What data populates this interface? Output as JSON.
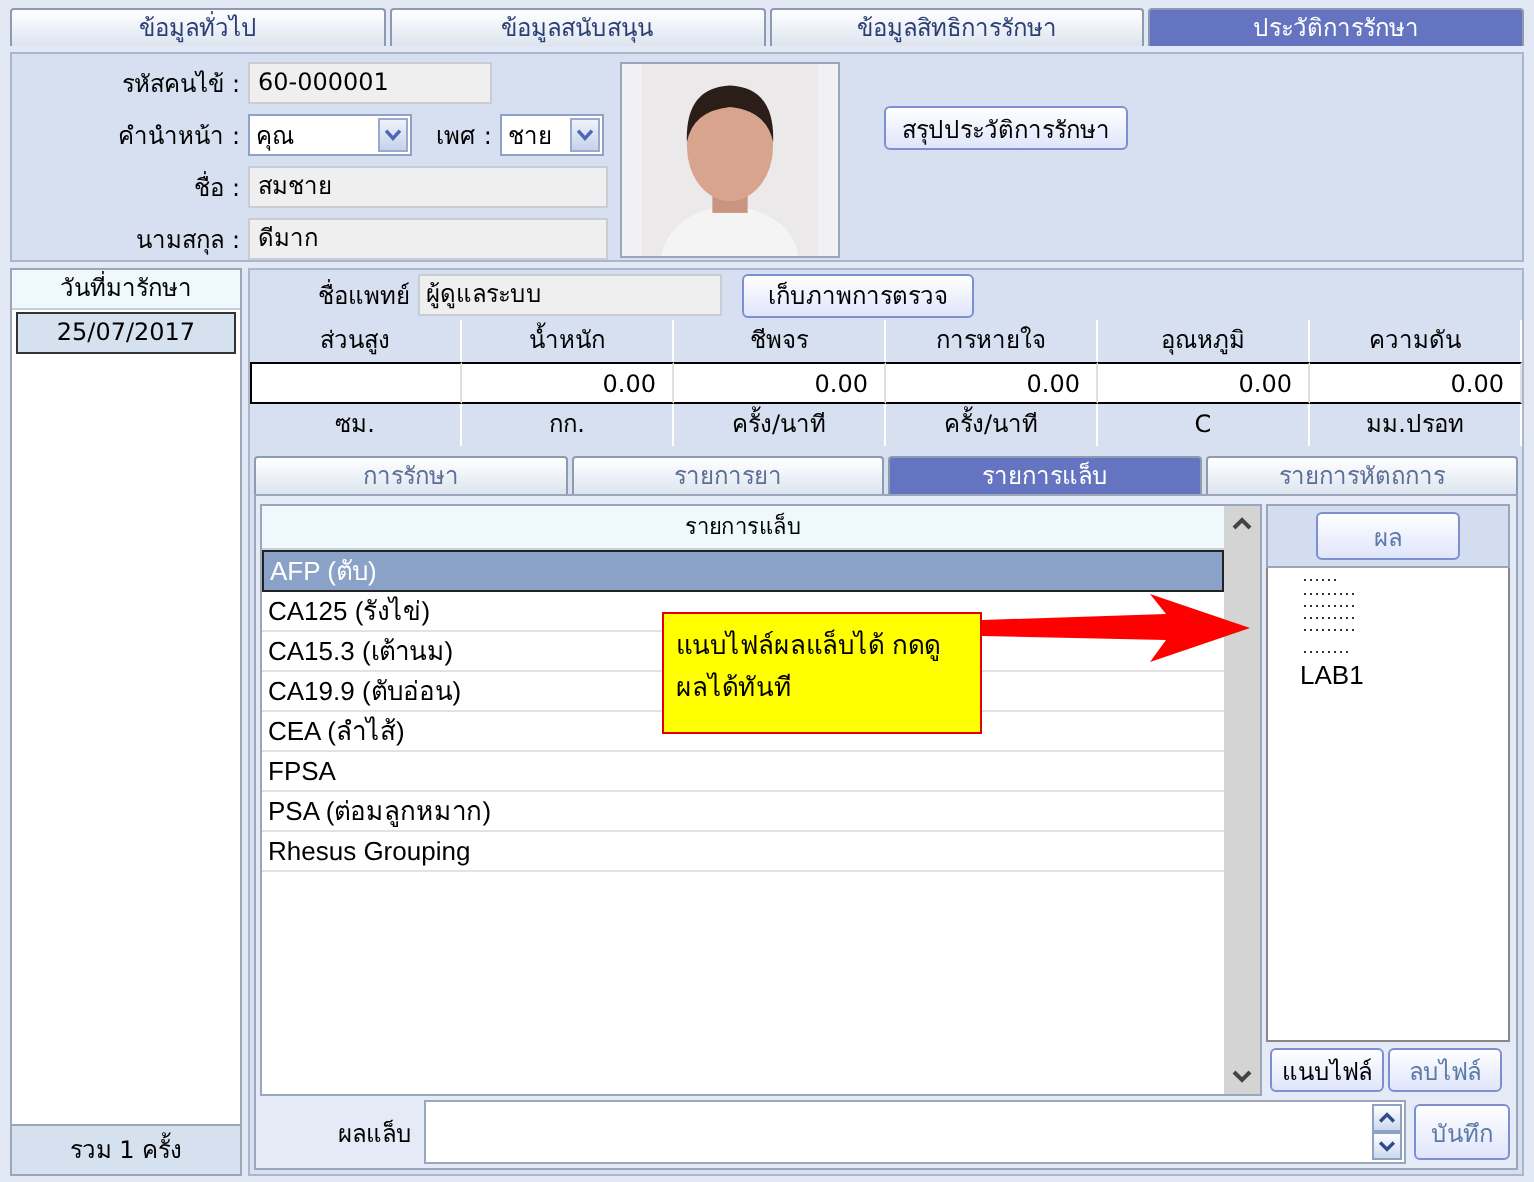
{
  "main_tabs": [
    {
      "label": "ข้อมูลทั่วไป",
      "selected": false
    },
    {
      "label": "ข้อมูลสนับสนุน",
      "selected": false
    },
    {
      "label": "ข้อมูลสิทธิการรักษา",
      "selected": false
    },
    {
      "label": "ประวัติการรักษา",
      "selected": true
    }
  ],
  "patient": {
    "id_label": "รหัสคนไข้ :",
    "id": "60-000001",
    "title_label": "คำนำหน้า :",
    "title": "คุณ",
    "sex_label": "เพศ :",
    "sex": "ชาย",
    "name_label": "ชื่อ :",
    "name": "สมชาย",
    "surname_label": "นามสกุล :",
    "surname": "ดีมาก",
    "summary_button": {
      "label": "สรุปประวัติการรักษา",
      "disabled": false
    }
  },
  "visits": {
    "header": "วันที่มารักษา",
    "items": [
      {
        "date": "25/07/2017",
        "selected": true
      }
    ],
    "footer": "รวม 1 ครั้ง"
  },
  "doctor": {
    "label": "ชื่อแพทย์",
    "value": "ผู้ดูแลระบบ",
    "button": {
      "label": "เก็บภาพการตรวจ",
      "disabled": false
    }
  },
  "vitals": {
    "columns": [
      {
        "name": "ส่วนสูง",
        "unit": "ซม."
      },
      {
        "name": "น้ำหนัก",
        "value": "0.00",
        "unit": "กก."
      },
      {
        "name": "ชีพจร",
        "value": "0.00",
        "unit": "ครั้ง/นาที"
      },
      {
        "name": "การหายใจ",
        "value": "0.00",
        "unit": "ครั้ง/นาที"
      },
      {
        "name": "อุณหภูมิ",
        "value": "0.00",
        "unit": "C"
      },
      {
        "name": "ความดัน",
        "value": "0.00",
        "unit": "มม.ปรอท"
      }
    ]
  },
  "sub_tabs": [
    {
      "label": "การรักษา",
      "selected": false
    },
    {
      "label": "รายการยา",
      "selected": false
    },
    {
      "label": "รายการแล็บ",
      "selected": true
    },
    {
      "label": "รายการหัตถการ",
      "selected": false
    }
  ],
  "lab_list": {
    "header": "รายการแล็บ",
    "rows": [
      {
        "name": "AFP (ตับ)",
        "selected": true
      },
      {
        "name": "CA125 (รังไข่)",
        "selected": false
      },
      {
        "name": "CA15.3 (เต้านม)",
        "selected": false
      },
      {
        "name": "CA19.9 (ตับอ่อน)",
        "selected": false
      },
      {
        "name": "CEA (ลำไส้)",
        "selected": false
      },
      {
        "name": "FPSA",
        "selected": false
      },
      {
        "name": "PSA (ต่อมลูกหมาก)",
        "selected": false
      },
      {
        "name": "Rhesus Grouping",
        "selected": false
      }
    ]
  },
  "callout": {
    "text": "แนบไฟล์ผลแล็บได้ กดดูผลได้ทันที"
  },
  "result_panel": {
    "button": {
      "label": "ผล",
      "disabled": true
    },
    "files": [
      {
        "name": "LAB1"
      }
    ],
    "attach_button": {
      "label": "แนบไฟล์",
      "disabled": false
    },
    "delete_button": {
      "label": "ลบไฟล์",
      "disabled": true
    }
  },
  "lab_result": {
    "label": "ผลแล็บ",
    "save_button": {
      "label": "บันทึก",
      "disabled": true
    }
  }
}
